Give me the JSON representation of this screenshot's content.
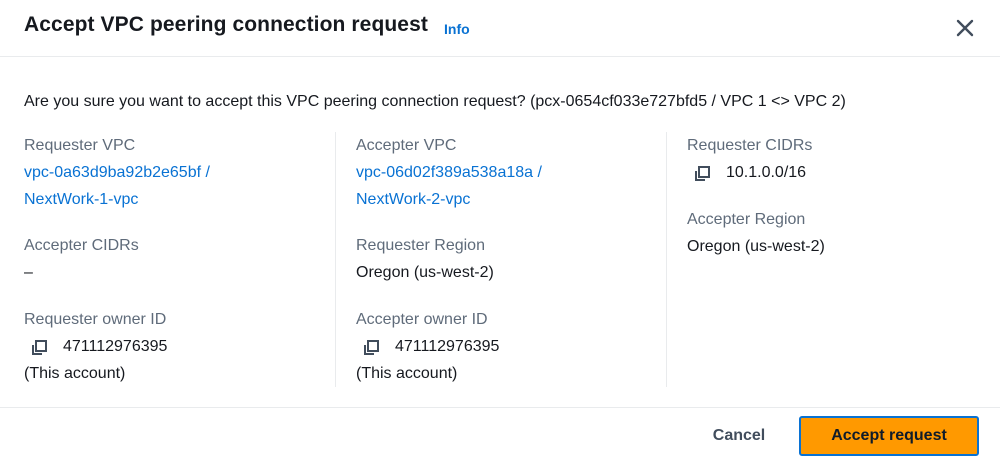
{
  "header": {
    "title": "Accept VPC peering connection request",
    "info_label": "Info"
  },
  "body": {
    "question": "Are you sure you want to accept this VPC peering connection request? (pcx-0654cf033e727bfd5 / VPC 1 <> VPC 2)",
    "requester_vpc": {
      "label": "Requester VPC",
      "link_line1": "vpc-0a63d9ba92b2e65bf /",
      "link_line2": "NextWork-1-vpc"
    },
    "accepter_cidrs": {
      "label": "Accepter CIDRs",
      "value": "–"
    },
    "requester_owner": {
      "label": "Requester owner ID",
      "value": "471112976395",
      "note": "(This account)"
    },
    "accepter_vpc": {
      "label": "Accepter VPC",
      "link_line1": "vpc-06d02f389a538a18a /",
      "link_line2": "NextWork-2-vpc"
    },
    "requester_region": {
      "label": "Requester Region",
      "value": "Oregon (us-west-2)"
    },
    "accepter_owner": {
      "label": "Accepter owner ID",
      "value": "471112976395",
      "note": "(This account)"
    },
    "requester_cidrs": {
      "label": "Requester CIDRs",
      "value": "10.1.0.0/16"
    },
    "accepter_region": {
      "label": "Accepter Region",
      "value": "Oregon (us-west-2)"
    }
  },
  "footer": {
    "cancel_label": "Cancel",
    "accept_label": "Accept request"
  },
  "icons": {
    "close": "close-icon",
    "copy": "copy-icon"
  },
  "colors": {
    "link": "#0972d3",
    "primary_button": "#ff9900",
    "label": "#5f6b7a",
    "text": "#16191f"
  }
}
